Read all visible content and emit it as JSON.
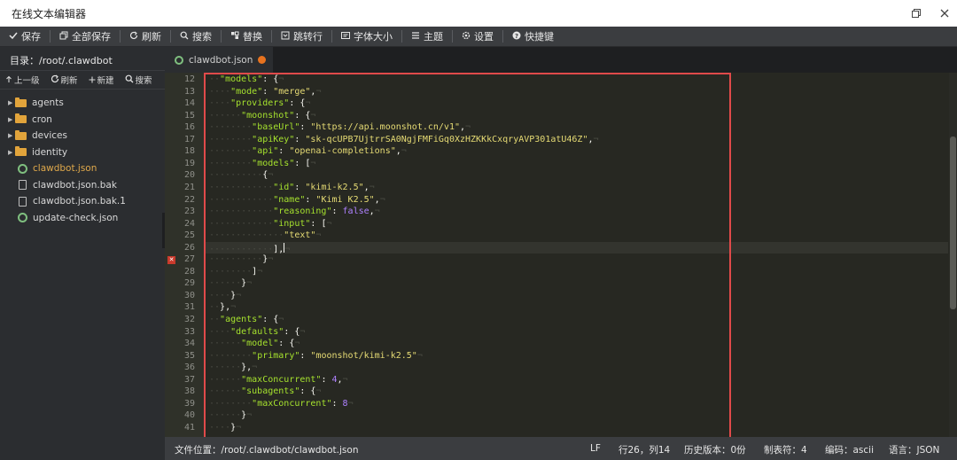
{
  "window": {
    "title": "在线文本编辑器",
    "restore_icon": "restore-window-icon",
    "close_icon": "close-icon"
  },
  "toolbar": {
    "items": [
      {
        "label": "保存",
        "icon": "check-icon"
      },
      {
        "label": "全部保存",
        "icon": "copy-icon"
      },
      {
        "label": "刷新",
        "icon": "refresh-icon"
      },
      {
        "label": "搜索",
        "icon": "search-icon"
      },
      {
        "label": "替换",
        "icon": "replace-icon"
      },
      {
        "label": "跳转行",
        "icon": "goto-line-icon"
      },
      {
        "label": "字体大小",
        "icon": "font-size-icon"
      },
      {
        "label": "主题",
        "icon": "theme-icon"
      },
      {
        "label": "设置",
        "icon": "gear-icon"
      },
      {
        "label": "快捷键",
        "icon": "help-icon"
      }
    ]
  },
  "sidebar": {
    "path_label": "目录：/root/.clawdbot",
    "actions": [
      {
        "label": "上一级",
        "icon": "arrow-up-icon"
      },
      {
        "label": "刷新",
        "icon": "refresh-icon"
      },
      {
        "label": "新建",
        "icon": "plus-icon"
      },
      {
        "label": "搜索",
        "icon": "search-icon"
      }
    ],
    "tree": [
      {
        "name": "agents",
        "type": "folder"
      },
      {
        "name": "cron",
        "type": "folder"
      },
      {
        "name": "devices",
        "type": "folder"
      },
      {
        "name": "identity",
        "type": "folder"
      },
      {
        "name": "clawdbot.json",
        "type": "json",
        "active": true
      },
      {
        "name": "clawdbot.json.bak",
        "type": "file"
      },
      {
        "name": "clawdbot.json.bak.1",
        "type": "file"
      },
      {
        "name": "update-check.json",
        "type": "json"
      }
    ]
  },
  "tab": {
    "label": "clawdbot.json",
    "modified": true
  },
  "editor": {
    "cursor_line": 26,
    "error_line": 27,
    "lines": [
      {
        "n": "12",
        "indent": 1,
        "tokens": [
          [
            "k",
            "\"models\""
          ],
          [
            "p",
            ": {"
          ]
        ]
      },
      {
        "n": "13",
        "indent": 2,
        "tokens": [
          [
            "k",
            "\"mode\""
          ],
          [
            "p",
            ": "
          ],
          [
            "s",
            "\"merge\""
          ],
          [
            "p",
            ","
          ]
        ]
      },
      {
        "n": "14",
        "indent": 2,
        "tokens": [
          [
            "k",
            "\"providers\""
          ],
          [
            "p",
            ": {"
          ]
        ]
      },
      {
        "n": "15",
        "indent": 3,
        "tokens": [
          [
            "k",
            "\"moonshot\""
          ],
          [
            "p",
            ": {"
          ]
        ]
      },
      {
        "n": "16",
        "indent": 4,
        "tokens": [
          [
            "k",
            "\"baseUrl\""
          ],
          [
            "p",
            ": "
          ],
          [
            "s",
            "\"https://api.moonshot.cn/v1\""
          ],
          [
            "p",
            ","
          ]
        ]
      },
      {
        "n": "17",
        "indent": 4,
        "tokens": [
          [
            "k",
            "\"apiKey\""
          ],
          [
            "p",
            ": "
          ],
          [
            "s",
            "\"sk-qcUPB7UjtrrSA0NgjFMFiGq0XzHZKKkCxqryAVP301atU46Z\""
          ],
          [
            "p",
            ","
          ]
        ]
      },
      {
        "n": "18",
        "indent": 4,
        "tokens": [
          [
            "k",
            "\"api\""
          ],
          [
            "p",
            ": "
          ],
          [
            "s",
            "\"openai-completions\""
          ],
          [
            "p",
            ","
          ]
        ]
      },
      {
        "n": "19",
        "indent": 4,
        "tokens": [
          [
            "k",
            "\"models\""
          ],
          [
            "p",
            ": ["
          ]
        ]
      },
      {
        "n": "20",
        "indent": 5,
        "tokens": [
          [
            "p",
            "{"
          ]
        ]
      },
      {
        "n": "21",
        "indent": 6,
        "tokens": [
          [
            "k",
            "\"id\""
          ],
          [
            "p",
            ": "
          ],
          [
            "s",
            "\"kimi-k2.5\""
          ],
          [
            "p",
            ","
          ]
        ]
      },
      {
        "n": "22",
        "indent": 6,
        "tokens": [
          [
            "k",
            "\"name\""
          ],
          [
            "p",
            ": "
          ],
          [
            "s",
            "\"Kimi K2.5\""
          ],
          [
            "p",
            ","
          ]
        ]
      },
      {
        "n": "23",
        "indent": 6,
        "tokens": [
          [
            "k",
            "\"reasoning\""
          ],
          [
            "p",
            ": "
          ],
          [
            "n",
            "false"
          ],
          [
            "p",
            ","
          ]
        ]
      },
      {
        "n": "24",
        "indent": 6,
        "tokens": [
          [
            "k",
            "\"input\""
          ],
          [
            "p",
            ": ["
          ]
        ]
      },
      {
        "n": "25",
        "indent": 7,
        "tokens": [
          [
            "s",
            "\"text\""
          ]
        ]
      },
      {
        "n": "26",
        "indent": 6,
        "tokens": [
          [
            "p",
            "],"
          ]
        ]
      },
      {
        "n": "27",
        "indent": 5,
        "tokens": [
          [
            "p",
            "}"
          ]
        ]
      },
      {
        "n": "28",
        "indent": 4,
        "tokens": [
          [
            "p",
            "]"
          ]
        ]
      },
      {
        "n": "29",
        "indent": 3,
        "tokens": [
          [
            "p",
            "}"
          ]
        ]
      },
      {
        "n": "30",
        "indent": 2,
        "tokens": [
          [
            "p",
            "}"
          ]
        ]
      },
      {
        "n": "31",
        "indent": 1,
        "tokens": [
          [
            "p",
            "},"
          ]
        ]
      },
      {
        "n": "32",
        "indent": 1,
        "tokens": [
          [
            "k",
            "\"agents\""
          ],
          [
            "p",
            ": {"
          ]
        ]
      },
      {
        "n": "33",
        "indent": 2,
        "tokens": [
          [
            "k",
            "\"defaults\""
          ],
          [
            "p",
            ": {"
          ]
        ]
      },
      {
        "n": "34",
        "indent": 3,
        "tokens": [
          [
            "k",
            "\"model\""
          ],
          [
            "p",
            ": {"
          ]
        ]
      },
      {
        "n": "35",
        "indent": 4,
        "tokens": [
          [
            "k",
            "\"primary\""
          ],
          [
            "p",
            ": "
          ],
          [
            "s",
            "\"moonshot/kimi-k2.5\""
          ]
        ]
      },
      {
        "n": "36",
        "indent": 3,
        "tokens": [
          [
            "p",
            "},"
          ]
        ]
      },
      {
        "n": "37",
        "indent": 3,
        "tokens": [
          [
            "k",
            "\"maxConcurrent\""
          ],
          [
            "p",
            ": "
          ],
          [
            "n",
            "4"
          ],
          [
            "p",
            ","
          ]
        ]
      },
      {
        "n": "38",
        "indent": 3,
        "tokens": [
          [
            "k",
            "\"subagents\""
          ],
          [
            "p",
            ": {"
          ]
        ]
      },
      {
        "n": "39",
        "indent": 4,
        "tokens": [
          [
            "k",
            "\"maxConcurrent\""
          ],
          [
            "p",
            ": "
          ],
          [
            "n",
            "8"
          ]
        ]
      },
      {
        "n": "40",
        "indent": 3,
        "tokens": [
          [
            "p",
            "}"
          ]
        ]
      },
      {
        "n": "41",
        "indent": 2,
        "tokens": [
          [
            "p",
            "}"
          ]
        ]
      }
    ]
  },
  "statusbar": {
    "file_location": "文件位置：/root/.clawdbot/clawdbot.json",
    "line_ending": "LF",
    "cursor_pos": "行26，列14",
    "history": "历史版本：0份",
    "tab_size": "制表符：4",
    "encoding": "编码：ascii",
    "language": "语言：JSON"
  },
  "colors": {
    "editor_bg": "#272822",
    "key": "#a6e22e",
    "string": "#e6db74",
    "number": "#ae81ff",
    "highlight_border": "#e04a4a"
  }
}
